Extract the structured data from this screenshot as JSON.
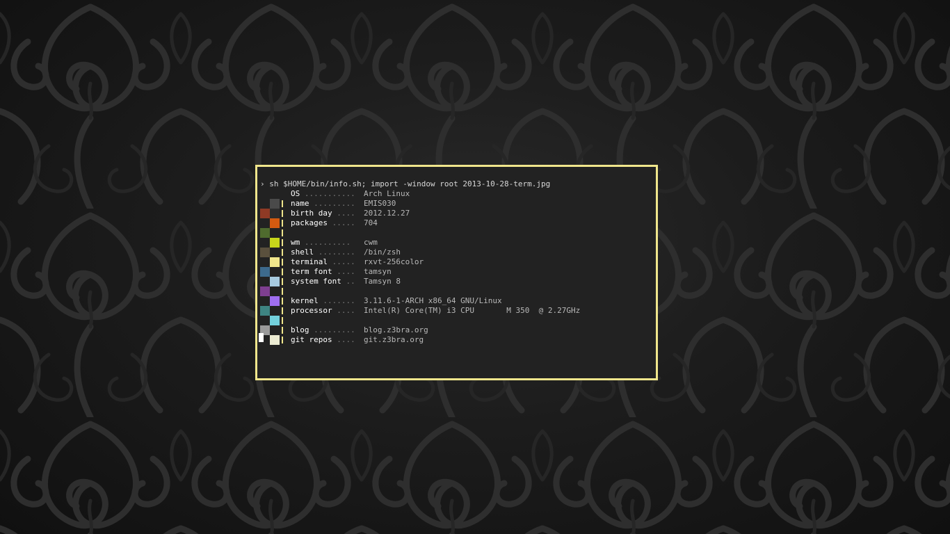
{
  "desktop": {
    "wallpaper": "dark-damask-pattern",
    "colors": {
      "background": "#141414",
      "pattern": "#2c2c2c",
      "terminal_bg": "#222222",
      "terminal_border": "#f0e68c"
    }
  },
  "terminal": {
    "prompt_symbol": "›",
    "command": "sh $HOME/bin/info.sh; import -window root 2013-10-28-term.jpg",
    "rows": [
      {
        "key": "OS",
        "dots": "...........",
        "value": "Arch Linux",
        "swatch_left": "",
        "swatch_right": "",
        "bar": false
      },
      {
        "key": "name",
        "dots": ".........",
        "value": "EMIS030",
        "swatch_left": "",
        "swatch_right": "#4a4a4a",
        "bar": true
      },
      {
        "key": "birth day",
        "dots": "....",
        "value": "2012.12.27",
        "swatch_left": "#8f3a25",
        "swatch_right": "#2c2c2c",
        "bar": true
      },
      {
        "key": "packages",
        "dots": ".....",
        "value": "704",
        "swatch_left": "",
        "swatch_right": "#d35a10",
        "bar": true
      },
      {
        "key": "",
        "dots": "",
        "value": "",
        "swatch_left": "#4f6b2e",
        "swatch_right": "",
        "bar": true
      },
      {
        "key": "wm",
        "dots": "..........",
        "value": "cwm",
        "swatch_left": "",
        "swatch_right": "#c7d61a",
        "bar": true
      },
      {
        "key": "shell",
        "dots": "........",
        "value": "/bin/zsh",
        "swatch_left": "#5a503d",
        "swatch_right": "",
        "bar": true
      },
      {
        "key": "terminal",
        "dots": ".....",
        "value": "rxvt-256color",
        "swatch_left": "",
        "swatch_right": "#f0e68c",
        "bar": true
      },
      {
        "key": "term font",
        "dots": "....",
        "value": "tamsyn",
        "swatch_left": "#3d6a8c",
        "swatch_right": "",
        "bar": true
      },
      {
        "key": "system font",
        "dots": "..",
        "value": "Tamsyn 8",
        "swatch_left": "",
        "swatch_right": "#a7cbe0",
        "bar": true
      },
      {
        "key": "",
        "dots": "",
        "value": "",
        "swatch_left": "#7e3f90",
        "swatch_right": "",
        "bar": true
      },
      {
        "key": "kernel",
        "dots": ".......",
        "value": "3.11.6-1-ARCH x86_64 GNU/Linux",
        "swatch_left": "",
        "swatch_right": "#9f6ef0",
        "bar": true
      },
      {
        "key": "processor",
        "dots": "....",
        "value": "Intel(R) Core(TM) i3 CPU       M 350  @ 2.27GHz",
        "swatch_left": "#3e8482",
        "swatch_right": "",
        "bar": true
      },
      {
        "key": "",
        "dots": "",
        "value": "",
        "swatch_left": "",
        "swatch_right": "#72d0dc",
        "bar": true
      },
      {
        "key": "blog",
        "dots": ".........",
        "value": "blog.z3bra.org",
        "swatch_left": "#9a9a9a",
        "swatch_right": "",
        "bar": true
      },
      {
        "key": "git repos",
        "dots": "....",
        "value": "git.z3bra.org",
        "swatch_left": "",
        "swatch_right": "#ecebd2",
        "bar": true
      }
    ]
  }
}
